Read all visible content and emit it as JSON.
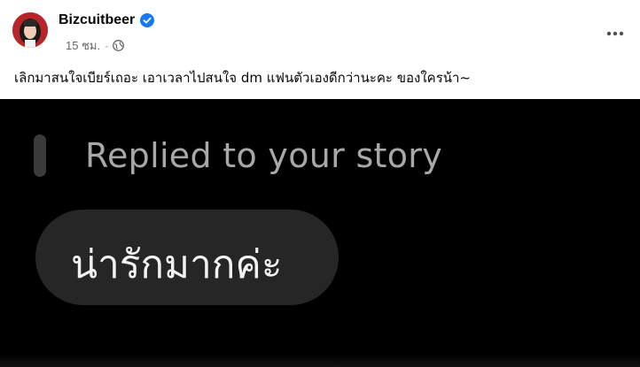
{
  "post": {
    "author": "Bizcuitbeer",
    "time": "15 ชม.",
    "separator": "·",
    "caption": "เลิกมาสนใจเบียร์เถอะ เอาเวลาไปสนใจ dm แฟนตัวเองดีกว่านะคะ ของใครน้า~"
  },
  "media": {
    "reply_label": "Replied to your story",
    "message": "น่ารักมากค่ะ"
  },
  "icons": {
    "verified": "verified-badge-icon",
    "audience": "globe-icon",
    "more": "more-options-icon"
  },
  "colors": {
    "verified": "#1877f2",
    "meta_text": "#65676b",
    "media_background": "#000000",
    "bubble": "#262626"
  }
}
